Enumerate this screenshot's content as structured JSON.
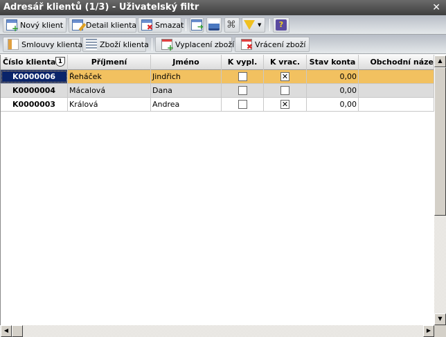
{
  "window": {
    "title": "Adresář klientů  (1/3) - Uživatelský filtr",
    "close": "✕"
  },
  "toolbar1": {
    "new_client": "Nový klient",
    "detail_client": "Detail klienta",
    "delete": "Smazat"
  },
  "toolbar2": {
    "contracts": "Smlouvy klienta",
    "goods": "Zboží klienta",
    "payout": "Vyplacení zboží",
    "return": "Vrácení zboží"
  },
  "table": {
    "columns": [
      "Číslo klienta",
      "Příjmení",
      "Jméno",
      "K vypl.",
      "K vrac.",
      "Stav konta",
      "Obchodní náze"
    ],
    "sort_badge": "1",
    "rows": [
      {
        "id": "K0000006",
        "surname": "Řeháček",
        "name": "Jindřich",
        "k_vypl": false,
        "k_vrac": true,
        "balance": "0,00",
        "business": ""
      },
      {
        "id": "K0000004",
        "surname": "Mácalová",
        "name": "Dana",
        "k_vypl": false,
        "k_vrac": false,
        "balance": "0,00",
        "business": ""
      },
      {
        "id": "K0000003",
        "surname": "Králová",
        "name": "Andrea",
        "k_vypl": false,
        "k_vrac": true,
        "balance": "0,00",
        "business": ""
      }
    ]
  },
  "colors": {
    "selected_row": "#f2c160",
    "selected_cell": "#0a246a",
    "alt_row": "#dcdcdc"
  }
}
